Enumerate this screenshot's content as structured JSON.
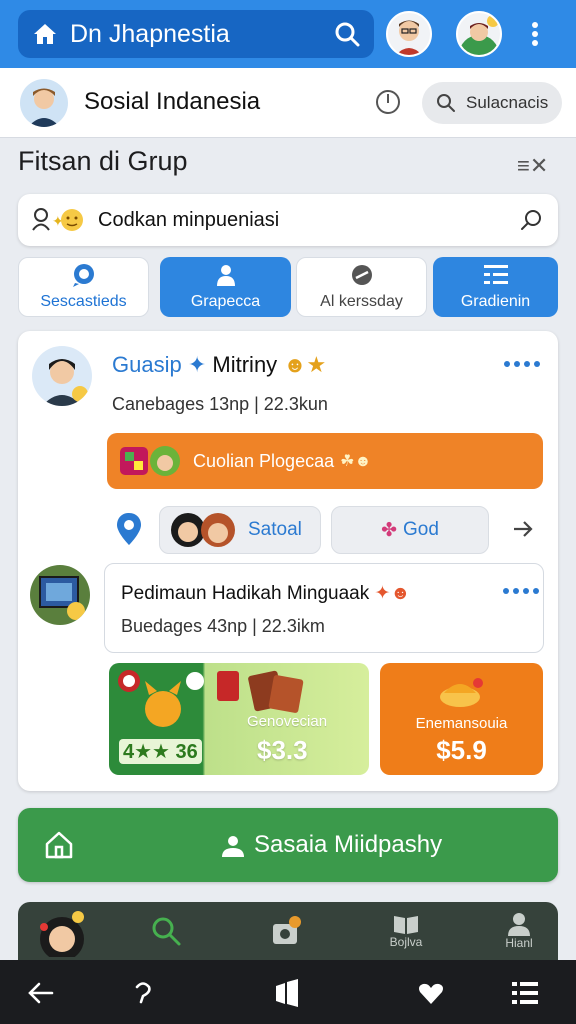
{
  "topbar": {
    "title": "Dn Jhapnestia",
    "icons": [
      "home-icon",
      "search-icon",
      "avatar",
      "avatar",
      "more-vertical-icon"
    ]
  },
  "profile_bar": {
    "title": "Sosial Indanesia",
    "search_placeholder": "Sulacnacis"
  },
  "section": {
    "title": "Fitsan di Grup"
  },
  "filter": {
    "value": "Codkan minpueniasi"
  },
  "tabs": [
    {
      "label": "Sescastieds",
      "style": "white"
    },
    {
      "label": "Grapecca",
      "style": "blue"
    },
    {
      "label": "Al kerssday",
      "style": "gray"
    },
    {
      "label": "Gradienin",
      "style": "blue"
    }
  ],
  "post": {
    "name_blue": "Guasip",
    "name_dark": "Mitriny",
    "meta": "Canebages 13np | 22.3kun",
    "banner_text": "Cuolian Plogecaa",
    "chips": [
      {
        "label": "Satoal"
      },
      {
        "label": "God"
      }
    ],
    "sub": {
      "title": "Pedimaun Hadikah Minguaak",
      "meta": "Buedages 43np | 22.3ikm"
    },
    "promos": [
      {
        "score": "4★★ 36",
        "label": "Genovecian",
        "price": "$3.3"
      },
      {
        "label": "Enemansouia",
        "price": "$5.9"
      }
    ]
  },
  "cta": {
    "label": "Sasaia Miidpashy"
  },
  "bottom_tabs": [
    {
      "label": "",
      "icon": "avatar"
    },
    {
      "label": "",
      "icon": "search-icon"
    },
    {
      "label": "",
      "icon": "camera-icon"
    },
    {
      "label": "Bojlva",
      "icon": "book-icon"
    },
    {
      "label": "Hianl",
      "icon": "person-icon"
    }
  ],
  "colors": {
    "brand_blue": "#2f8ae6",
    "brand_green": "#3b9a4b",
    "accent_orange": "#ef8327"
  }
}
